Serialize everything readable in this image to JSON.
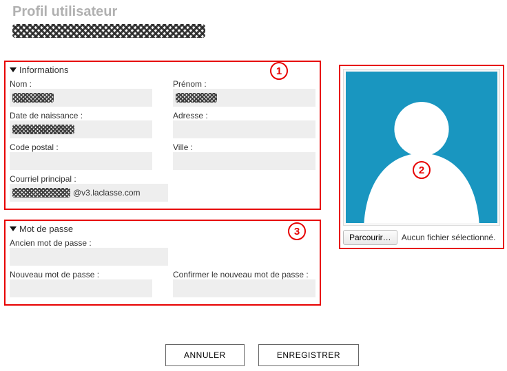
{
  "page": {
    "title": "Profil utilisateur",
    "user_display_name": ""
  },
  "annotations": {
    "a1": "1",
    "a2": "2",
    "a3": "3"
  },
  "info": {
    "header": "Informations",
    "nom_label": "Nom :",
    "nom_value": "",
    "prenom_label": "Prénom :",
    "prenom_value": "",
    "dob_label": "Date de naissance :",
    "dob_value": "",
    "adresse_label": "Adresse :",
    "adresse_value": "",
    "cp_label": "Code postal :",
    "cp_value": "",
    "ville_label": "Ville :",
    "ville_value": "",
    "email_label": "Courriel principal :",
    "email_value": "@v3.laclasse.com"
  },
  "pwd": {
    "header": "Mot de passe",
    "old_label": "Ancien mot de passe :",
    "new_label": "Nouveau mot de passe :",
    "confirm_label": "Confirmer le nouveau mot de passe :"
  },
  "avatar": {
    "browse_label": "Parcourir…",
    "nofile_text": "Aucun fichier sélectionné."
  },
  "actions": {
    "cancel": "ANNULER",
    "save": "ENREGISTRER"
  }
}
